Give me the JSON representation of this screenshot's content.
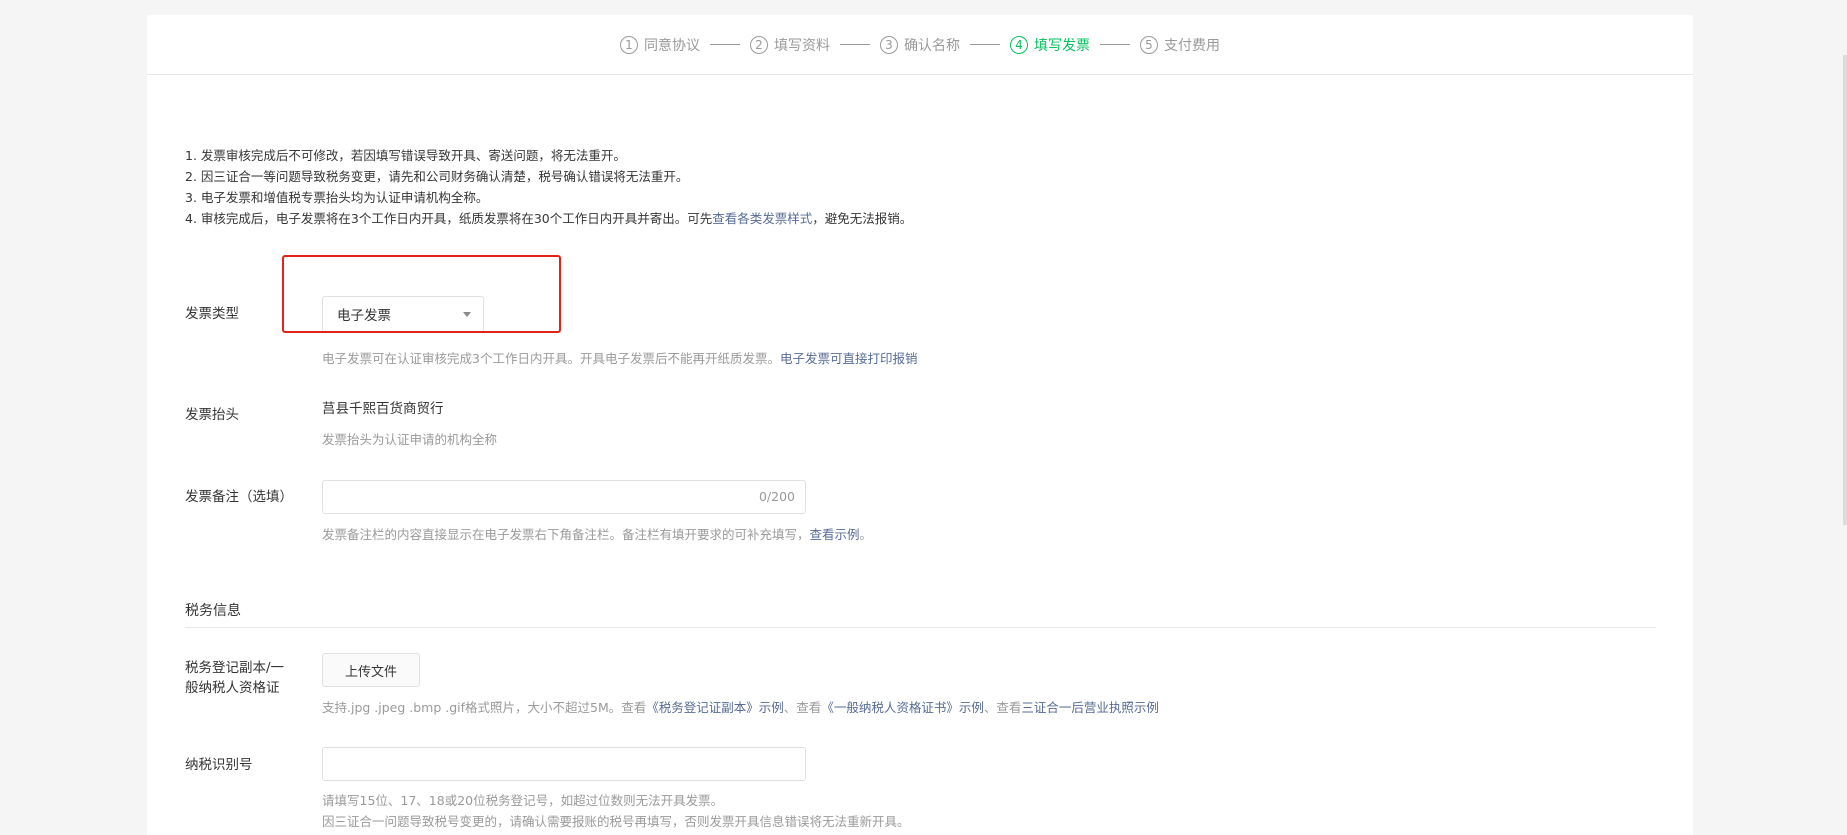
{
  "steps": [
    {
      "num": "1",
      "label": "同意协议",
      "active": false
    },
    {
      "num": "2",
      "label": "填写资料",
      "active": false
    },
    {
      "num": "3",
      "label": "确认名称",
      "active": false
    },
    {
      "num": "4",
      "label": "填写发票",
      "active": true
    },
    {
      "num": "5",
      "label": "支付费用",
      "active": false
    }
  ],
  "notes": {
    "n1": "1. 发票审核完成后不可修改，若因填写错误导致开具、寄送问题，将无法重开。",
    "n2": "2. 因三证合一等问题导致税务变更，请先和公司财务确认清楚，税号确认错误将无法重开。",
    "n3": "3. 电子发票和增值税专票抬头均为认证申请机构全称。",
    "n4_prefix": "4. 审核完成后，电子发票将在3个工作日内开具，纸质发票将在30个工作日内开具并寄出。可先",
    "n4_link": "查看各类发票样式",
    "n4_suffix": "，避免无法报销。"
  },
  "invoice_type": {
    "label": "发票类型",
    "selected": "电子发票",
    "hint_prefix": "电子发票可在认证审核完成3个工作日内开具。开具电子发票后不能再开纸质发票。",
    "hint_link": "电子发票可直接打印报销"
  },
  "invoice_title": {
    "label": "发票抬头",
    "value": "莒县千熙百货商贸行",
    "hint": "发票抬头为认证申请的机构全称"
  },
  "invoice_remark": {
    "label": "发票备注（选填）",
    "counter": "0/200",
    "hint_prefix": "发票备注栏的内容直接显示在电子发票右下角备注栏。备注栏有填开要求的可补充填写，",
    "hint_link": "查看示例",
    "hint_suffix": "。"
  },
  "tax_section": {
    "title": "税务信息"
  },
  "tax_cert": {
    "label_line1": "税务登记副本/一",
    "label_line2": "般纳税人资格证",
    "button": "上传文件",
    "hint_prefix": "支持.jpg .jpeg .bmp .gif格式照片，大小不超过5M。查看",
    "hint_link1": "《税务登记证副本》示例",
    "hint_mid": "、查看",
    "hint_link2": "《一般纳税人资格证书》示例",
    "hint_sep": "、查看",
    "hint_link3": "三证合一后营业执照示例"
  },
  "tax_id": {
    "label": "纳税识别号",
    "hint1": "请填写15位、17、18或20位税务登记号，如超过位数则无法开具发票。",
    "hint2": "因三证合一问题导致税号变更的，请确认需要报账的税号再填写，否则发票开具信息错误将无法重新开具。"
  },
  "colors": {
    "active_step": "#07c160",
    "link": "#576b95",
    "highlight": "#e2231a"
  }
}
